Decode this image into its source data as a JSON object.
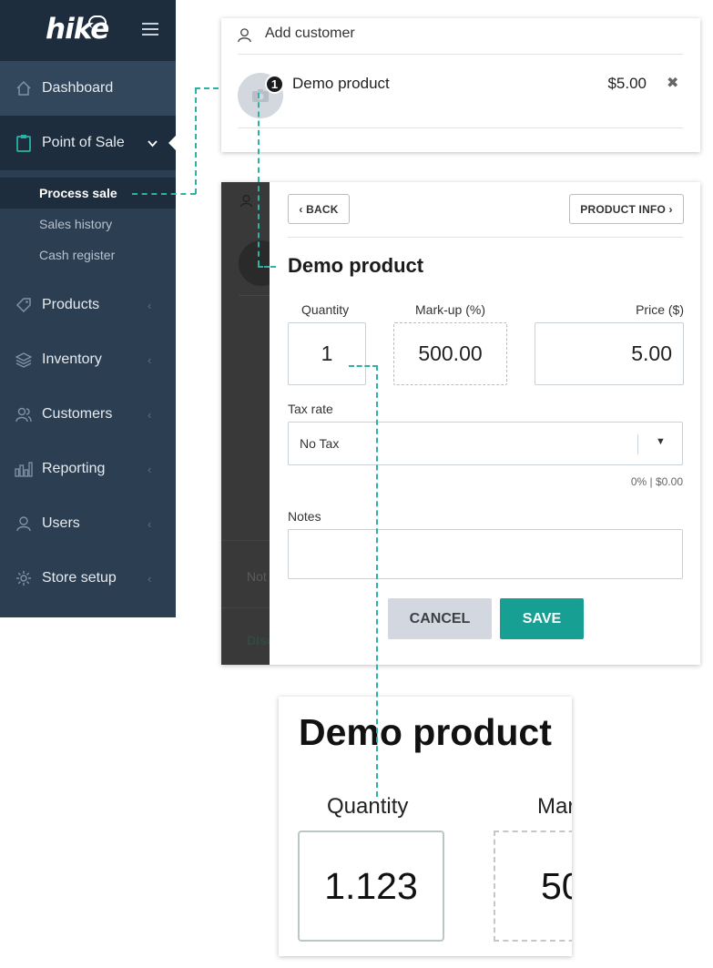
{
  "sidebar": {
    "brand": "hike",
    "nav": [
      {
        "label": "Dashboard",
        "icon": "home-icon"
      },
      {
        "label": "Point of Sale",
        "icon": "clipboard-icon"
      },
      {
        "label": "Products",
        "icon": "tag-icon"
      },
      {
        "label": "Inventory",
        "icon": "layers-icon"
      },
      {
        "label": "Customers",
        "icon": "users-icon"
      },
      {
        "label": "Reporting",
        "icon": "bar-chart-icon"
      },
      {
        "label": "Users",
        "icon": "user-icon"
      },
      {
        "label": "Store setup",
        "icon": "gear-icon"
      }
    ],
    "submenu": [
      {
        "label": "Process sale",
        "active": true
      },
      {
        "label": "Sales history",
        "active": false
      },
      {
        "label": "Cash register",
        "active": false
      }
    ]
  },
  "cart": {
    "add_customer": "Add customer",
    "item": {
      "quantity": "1",
      "name": "Demo product",
      "price": "$5.00",
      "remove": "✖"
    }
  },
  "edit_panel": {
    "back": "‹ BACK",
    "product_info": "PRODUCT INFO ›",
    "title": "Demo product",
    "quantity_label": "Quantity",
    "quantity_value": "1",
    "markup_label": "Mark-up (%)",
    "markup_value": "500.00",
    "price_label": "Price ($)",
    "price_value": "5.00",
    "tax_label": "Tax rate",
    "tax_value": "No Tax",
    "tax_summary": "0% | $0.00",
    "notes_label": "Notes",
    "cancel": "CANCEL",
    "save": "SAVE",
    "background_fragments": {
      "notes": "Not",
      "discount": "Disc"
    }
  },
  "zoom": {
    "title": "Demo product",
    "quantity_label": "Quantity",
    "quantity_value": "1.123",
    "markup_label_fragment": "Mar",
    "markup_value_fragment": "50"
  },
  "colors": {
    "sidebar": "#2c3e52",
    "sidebar_active": "#1d2d3e",
    "accent": "#179f93",
    "connector": "#2bb2a4",
    "cancel": "#d3d7e0"
  }
}
